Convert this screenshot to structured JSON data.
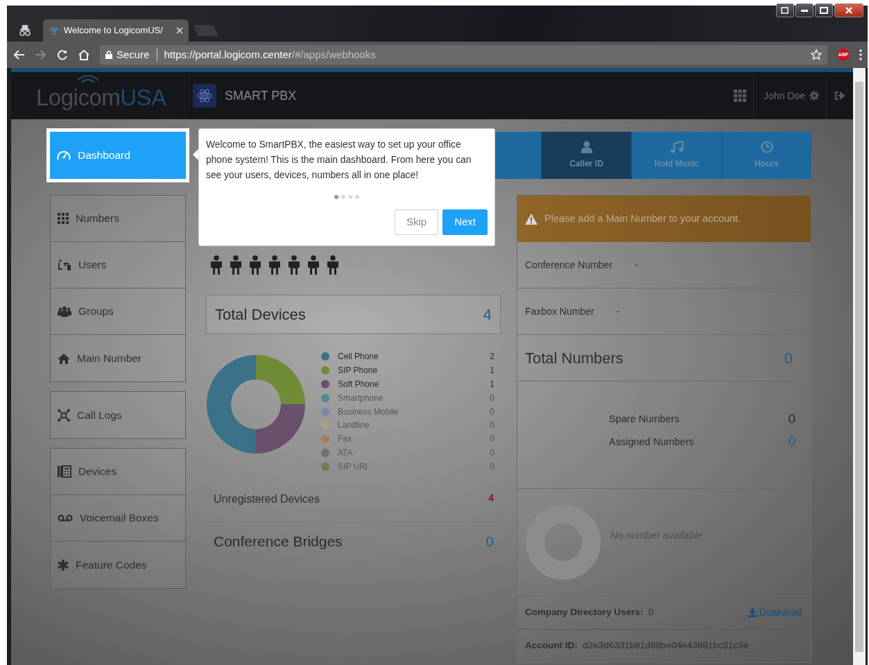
{
  "browser": {
    "tab_title": "Welcome to LogicomUS/",
    "secure_label": "Secure",
    "url_host": "https://portal.logicom.center",
    "url_path": "/#/apps/webhooks",
    "extension_badge": "ABP"
  },
  "header": {
    "logo": "Logicom",
    "logo_accent": "USA",
    "app_name": "SMART PBX",
    "user_name": "John Doe"
  },
  "sidebar": {
    "groups": [
      {
        "items": [
          {
            "label": "Dashboard",
            "selected": true
          }
        ]
      },
      {
        "items": [
          {
            "label": "Numbers",
            "selected": false
          },
          {
            "label": "Users",
            "selected": false
          },
          {
            "label": "Groups",
            "selected": false
          },
          {
            "label": "Main Number",
            "selected": false
          }
        ]
      },
      {
        "items": [
          {
            "label": "Call Logs",
            "selected": false
          }
        ]
      },
      {
        "items": [
          {
            "label": "Devices",
            "selected": false
          },
          {
            "label": "Voicemail Boxes",
            "selected": false
          },
          {
            "label": "Feature Codes",
            "selected": false
          }
        ]
      }
    ]
  },
  "shortcuts": [
    {
      "label": "Caller ID",
      "selected": true
    },
    {
      "label": "Hold Music",
      "selected": false
    },
    {
      "label": "Hours",
      "selected": false
    }
  ],
  "tour": {
    "text": "Welcome to SmartPBX, the easiest way to set up your office phone system! This is the main dashboard. From here you can see your users, devices, numbers all in one place!",
    "steps": [
      {
        "selected": true
      },
      {
        "selected": false
      },
      {
        "selected": false
      },
      {
        "selected": false
      }
    ],
    "buttons": [
      {
        "label": "Skip",
        "kind": "secondary"
      },
      {
        "label": "Next",
        "kind": "primary"
      }
    ]
  },
  "devices": {
    "total_label": "Total Devices",
    "total": "4",
    "chart_data": {
      "type": "donut",
      "categories": [
        "Cell Phone",
        "SIP Phone",
        "Soft Phone",
        "Smartphone",
        "Business Mobile",
        "Landline",
        "Fax",
        "ATA",
        "SIP URI"
      ],
      "values": [
        50,
        25,
        25,
        0,
        0,
        0,
        0,
        0,
        0
      ],
      "legend": "right"
    },
    "legend_items": [
      {
        "count": "2",
        "color": "#3b7189"
      },
      {
        "count": "1",
        "color": "#6f8b36"
      },
      {
        "count": "1",
        "color": "#694f6b"
      },
      {
        "count": "0",
        "color": "#4f8896"
      },
      {
        "count": "0",
        "color": "#7d86aa"
      },
      {
        "count": "0",
        "color": "#aaa47e"
      },
      {
        "count": "0",
        "color": "#a47c58"
      },
      {
        "count": "0",
        "color": "#6d7171"
      },
      {
        "count": "0",
        "color": "#6b7e4e"
      }
    ],
    "unregistered_label": "Unregistered Devices",
    "unregistered": "4",
    "conference_label": "Conference Bridges",
    "conference": "0"
  },
  "numbers": {
    "alert": "Please add a Main Number to your account.",
    "fields": [
      {
        "label": "Conference Number",
        "value": "-"
      },
      {
        "label": "Faxbox Number",
        "value": "-"
      }
    ],
    "total_label": "Total Numbers",
    "total": "0",
    "breakdown": [
      {
        "label": "Spare Numbers",
        "value": "0",
        "kind": "spare"
      },
      {
        "label": "Assigned Numbers",
        "value": "0",
        "kind": "assigned"
      }
    ],
    "empty_text": "No number available",
    "directory_label": "Company Directory Users:",
    "directory_count": "0",
    "download_label": "Download",
    "account_label": "Account ID:",
    "account_id": "d2e3d6331b81d89be04e43691bc31c3e"
  }
}
